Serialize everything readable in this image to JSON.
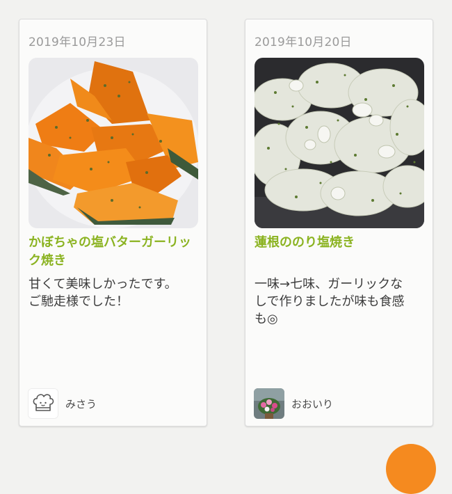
{
  "cards": [
    {
      "date": "2019年10月23日",
      "title": "かぼちゃの塩バターガーリック焼き",
      "comment": "甘くて美味しかったです。\nご馳走様でした！",
      "author": "みさう",
      "photo_icon": "pumpkin-photo",
      "avatar_icon": "chef-hat-icon"
    },
    {
      "date": "2019年10月20日",
      "title": "蓮根ののり塩焼き",
      "comment": "一味→七味、ガーリックなしで作りましたが味も食感も◎",
      "author": "おおいり",
      "photo_icon": "lotus-root-photo",
      "avatar_icon": "flower-photo-icon"
    }
  ],
  "colors": {
    "accent_title": "#8bb321",
    "fab": "#f58a1f",
    "date": "#9a9a9a"
  }
}
